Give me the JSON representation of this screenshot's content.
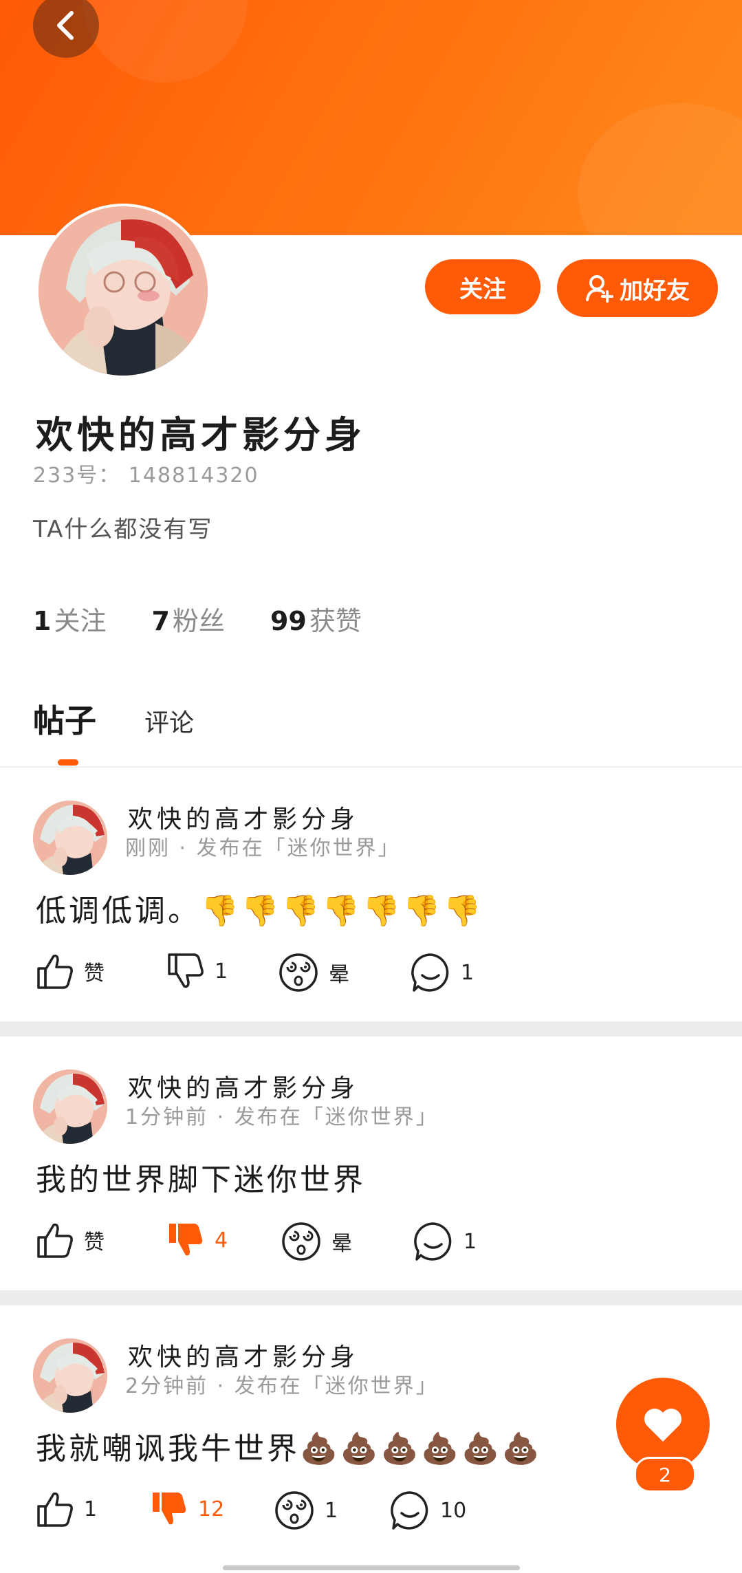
{
  "profile": {
    "username": "欢快的高才影分身",
    "uid": "233号： 148814320",
    "bio": "TA什么都没有写",
    "follow_label": "关注",
    "add_friend_label": "加好友",
    "stats": [
      {
        "num": "1",
        "label": "关注"
      },
      {
        "num": "7",
        "label": "粉丝"
      },
      {
        "num": "99",
        "label": "获赞"
      }
    ]
  },
  "tabs": [
    {
      "label": "帖子",
      "active": true
    },
    {
      "label": "评论",
      "active": false
    }
  ],
  "posts": [
    {
      "author": "欢快的高才影分身",
      "meta": "刚刚 · 发布在「迷你世界」",
      "text": "低调低调。👎👎👎👎👎👎👎",
      "actions": {
        "like": "赞",
        "dislike": "1",
        "dizzy": "晕",
        "comment": "1"
      },
      "dislike_active": false
    },
    {
      "author": "欢快的高才影分身",
      "meta": "1分钟前 · 发布在「迷你世界」",
      "text": "我的世界脚下迷你世界",
      "actions": {
        "like": "赞",
        "dislike": "4",
        "dizzy": "晕",
        "comment": "1"
      },
      "dislike_active": true
    },
    {
      "author": "欢快的高才影分身",
      "meta": "2分钟前 · 发布在「迷你世界」",
      "text": "我就嘲讽我牛世界💩💩💩💩💩💩",
      "actions": {
        "like": "1",
        "dislike": "12",
        "dizzy": "1",
        "comment": "10"
      },
      "dislike_active": true
    }
  ],
  "fab": {
    "badge": "2"
  },
  "colors": {
    "accent": "#ff5a08",
    "muted": "#9a9a9a"
  }
}
